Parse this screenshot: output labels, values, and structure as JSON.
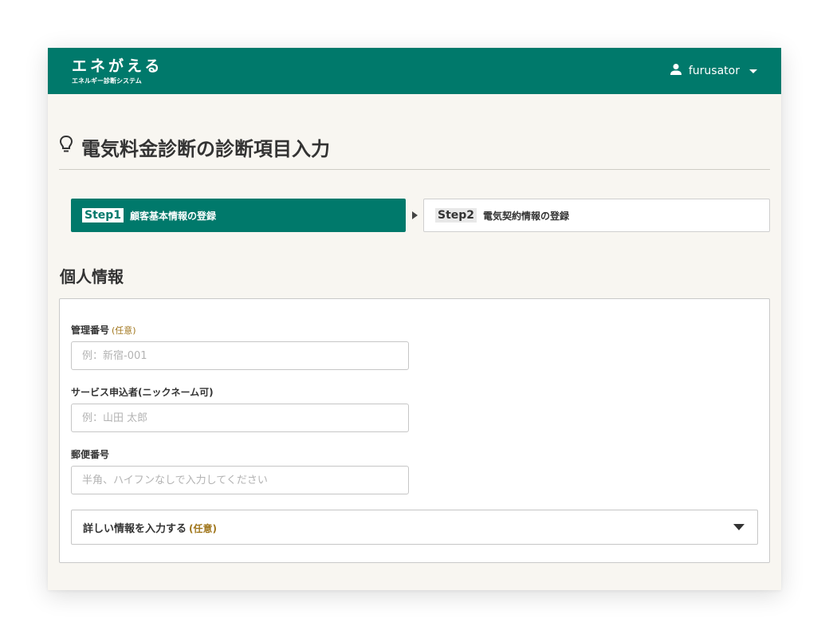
{
  "header": {
    "brand_title": "エネがえる",
    "brand_subtitle": "エネルギー診断システム",
    "username": "furusator",
    "user_icon": "person-icon"
  },
  "page": {
    "title": "電気料金診断の診断項目入力",
    "title_icon": "lightbulb-icon"
  },
  "steps": [
    {
      "badge": "Step1",
      "label": "顧客基本情報の登録",
      "active": true
    },
    {
      "badge": "Step2",
      "label": "電気契約情報の登録",
      "active": false
    }
  ],
  "section": {
    "title": "個人情報",
    "fields": {
      "management_number": {
        "label": "管理番号",
        "optional": "(任意)",
        "placeholder": "例：新宿-001",
        "value": ""
      },
      "applicant": {
        "label": "サービス申込者(ニックネーム可)",
        "placeholder": "例：山田 太郎",
        "value": ""
      },
      "postal_code": {
        "label": "郵便番号",
        "placeholder": "半角、ハイフンなしで入力してください",
        "value": ""
      }
    },
    "details_toggle": {
      "label": "詳しい情報を入力する",
      "optional": "(任意)"
    }
  },
  "colors": {
    "brand": "#00796b",
    "background": "#f8f6f1",
    "optional_text": "#a0761c"
  }
}
